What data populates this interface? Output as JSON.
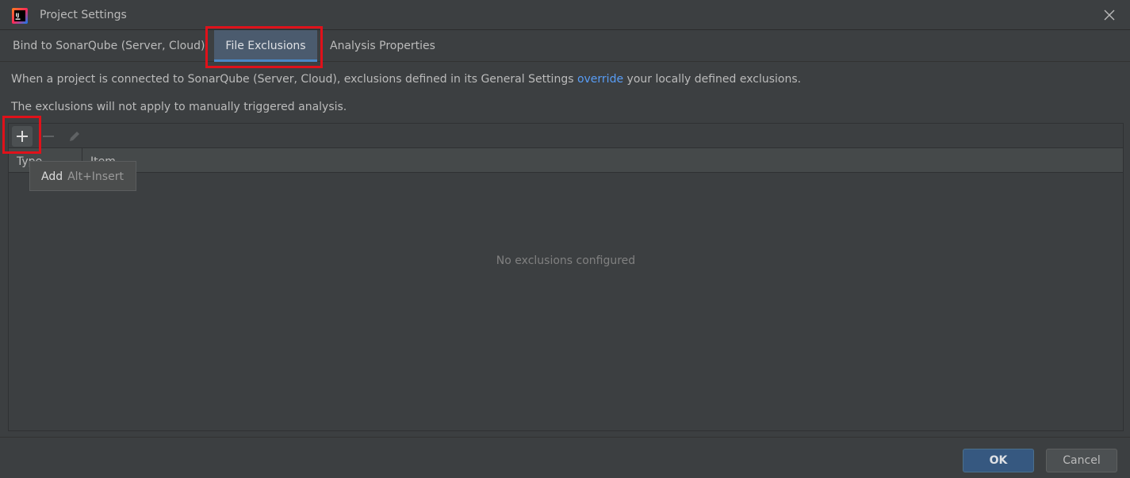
{
  "window": {
    "title": "Project Settings",
    "app_icon": "intellij-idea-icon",
    "close_icon": "close-icon"
  },
  "tabs": [
    {
      "label": "Bind to SonarQube (Server, Cloud)",
      "selected": false
    },
    {
      "label": "File Exclusions",
      "selected": true
    },
    {
      "label": "Analysis Properties",
      "selected": false
    }
  ],
  "description": {
    "line1_before": "When a project is connected to SonarQube (Server, Cloud), exclusions defined in its General Settings ",
    "line1_link": "override",
    "line1_after": " your locally defined exclusions.",
    "line2": "The exclusions will not apply to manually triggered analysis."
  },
  "toolbar": {
    "add_icon": "plus-icon",
    "remove_icon": "minus-icon",
    "edit_icon": "pencil-icon"
  },
  "table": {
    "columns": [
      "Type",
      "Item"
    ],
    "empty_text": "No exclusions configured"
  },
  "tooltip": {
    "label": "Add",
    "shortcut": "Alt+Insert"
  },
  "buttons": {
    "ok": "OK",
    "cancel": "Cancel"
  },
  "colors": {
    "background": "#3c3f41",
    "link": "#589df6",
    "selected_tab": "#4b5b6e",
    "tab_underline": "#4a88c7",
    "ok_button": "#365880",
    "highlight_box": "#e0111a"
  }
}
